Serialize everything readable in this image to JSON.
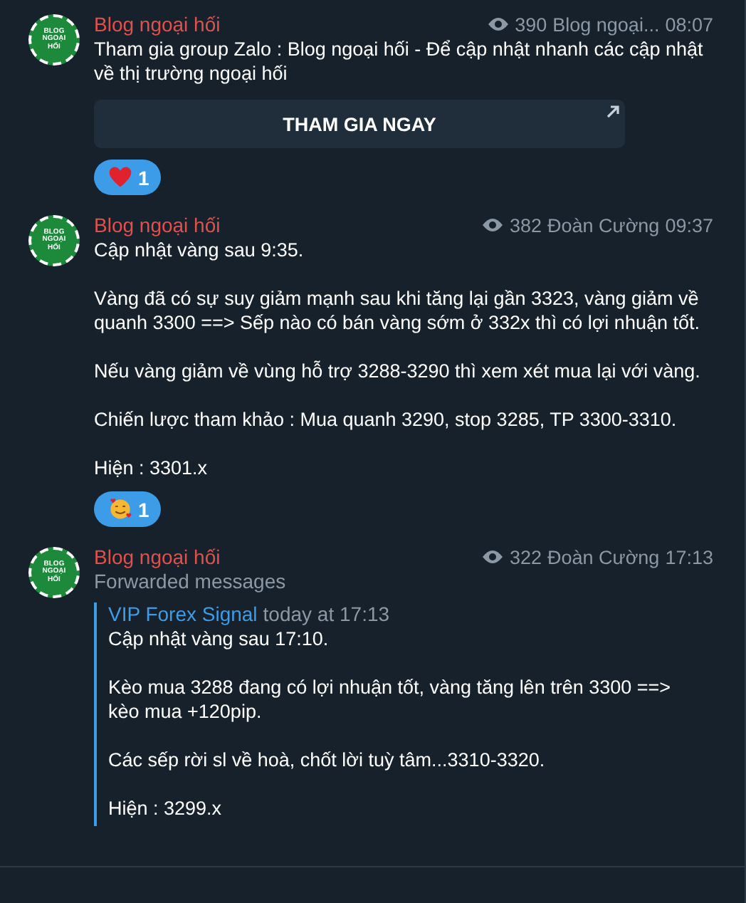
{
  "messages": [
    {
      "author": "Blog ngoại hối",
      "avatar_text": "BLOG NGOẠI HỐI",
      "views": "390",
      "signature": "Blog ngoại...",
      "time": "08:07",
      "paragraphs": [
        "Tham gia group Zalo : Blog ngoại hối - Để cập nhật nhanh các cập nhật về thị trường ngoại hối"
      ],
      "button": "THAM GIA NGAY",
      "reactions": [
        {
          "kind": "heart",
          "count": "1",
          "selected": true
        }
      ]
    },
    {
      "author": "Blog ngoại hối",
      "avatar_text": "BLOG NGOẠI HỐI",
      "views": "382",
      "signature": "Đoàn Cường",
      "time": "09:37",
      "paragraphs": [
        "Cập nhật vàng sau 9:35.",
        "Vàng đã có sự suy giảm mạnh sau khi tăng lại gần 3323, vàng giảm về quanh 3300 ==> Sếp nào có bán vàng sớm ở 332x thì có lợi nhuận tốt.",
        "Nếu vàng giảm về vùng hỗ trợ 3288-3290 thì xem xét mua lại với vàng.",
        "Chiến lược tham khảo : Mua quanh 3290, stop 3285, TP 3300-3310.",
        "Hiện : 3301.x"
      ],
      "reactions": [
        {
          "kind": "hearts-face",
          "count": "1",
          "selected": true
        }
      ]
    },
    {
      "author": "Blog ngoại hối",
      "avatar_text": "BLOG NGOẠI HỐI",
      "views": "322",
      "signature": "Đoàn Cường",
      "time": "17:13",
      "forwarded_label": "Forwarded messages",
      "forward": {
        "source": "VIP Forex Signal",
        "date": "today at 17:13",
        "paragraphs": [
          "Cập nhật vàng sau 17:10.",
          "Kèo mua 3288 đang có lợi nhuận tốt, vàng tăng lên trên 3300 ==> kèo mua +120pip.",
          "Các sếp rời sl về hoà, chốt lời tuỳ tâm...3310-3320.",
          "Hiện : 3299.x"
        ]
      }
    }
  ]
}
